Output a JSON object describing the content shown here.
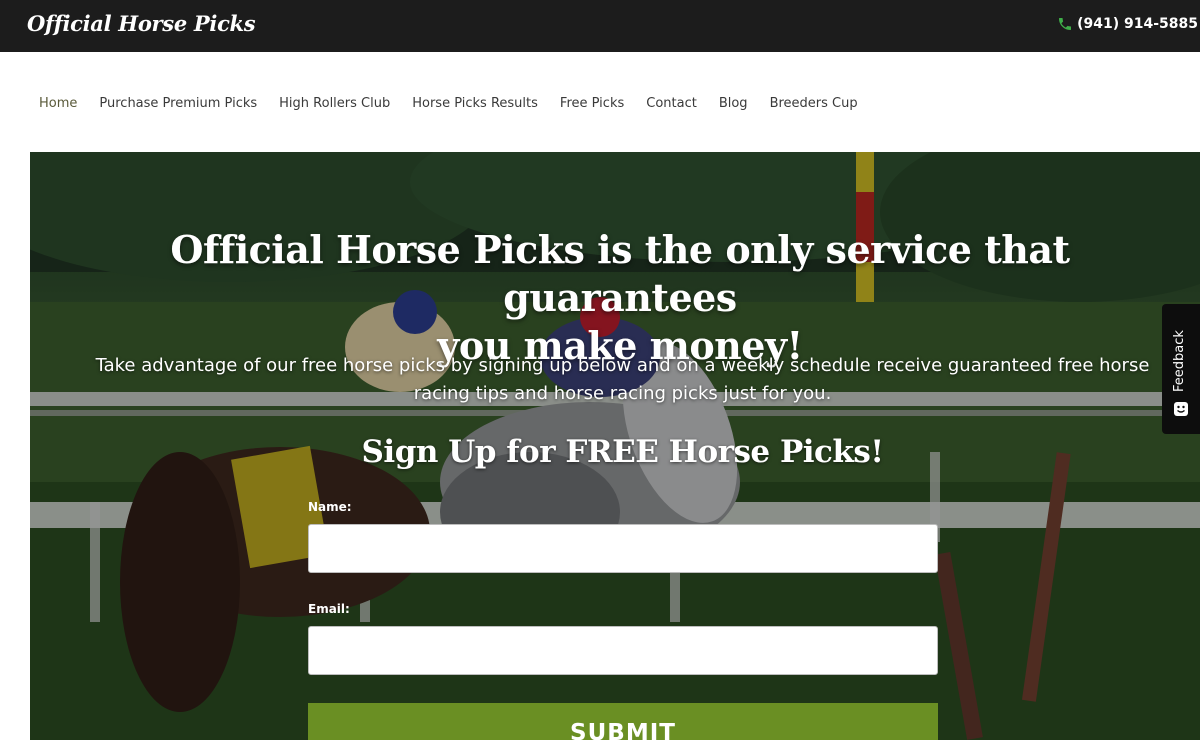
{
  "header": {
    "site_title": "Official Horse Picks",
    "phone": "(941) 914-5885",
    "phone_icon": "phone-icon"
  },
  "nav": {
    "items": [
      {
        "label": "Home",
        "active": true
      },
      {
        "label": "Purchase Premium Picks"
      },
      {
        "label": "High Rollers Club"
      },
      {
        "label": "Horse Picks Results"
      },
      {
        "label": "Free Picks"
      },
      {
        "label": "Contact"
      },
      {
        "label": "Blog"
      },
      {
        "label": "Breeders Cup"
      }
    ]
  },
  "hero": {
    "headline_line1": "Official Horse Picks is the only service that guarantees",
    "headline_line2": "you make money!",
    "subtext": "Take advantage of our free horse picks by signing up below and on a weekly schedule receive guaranteed free horse racing tips and horse racing picks just for you.",
    "signup_title": "Sign Up for FREE Horse Picks!"
  },
  "form": {
    "name_label": "Name:",
    "name_value": "",
    "email_label": "Email:",
    "email_value": "",
    "submit_label": "SUBMIT"
  },
  "feedback": {
    "label": "Feedback",
    "icon": "smile-icon"
  },
  "colors": {
    "topbar": "#1c1c1c",
    "submit": "#6a8f23",
    "phone_icon": "#3fae49"
  }
}
